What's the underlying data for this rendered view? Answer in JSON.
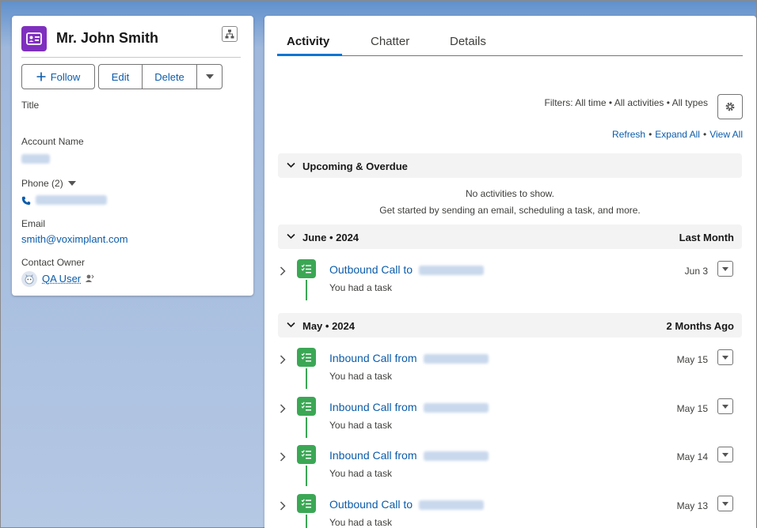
{
  "record": {
    "title": "Mr. John Smith",
    "actions": {
      "follow": "Follow",
      "edit": "Edit",
      "delete": "Delete"
    },
    "fields": {
      "title_label": "Title",
      "account_label": "Account Name",
      "phone_label": "Phone (2)",
      "email_label": "Email",
      "email_value": "smith@voximplant.com",
      "owner_label": "Contact Owner",
      "owner_value": "QA User"
    }
  },
  "tabs": [
    {
      "label": "Activity",
      "active": true
    },
    {
      "label": "Chatter",
      "active": false
    },
    {
      "label": "Details",
      "active": false
    }
  ],
  "activity": {
    "filters": "Filters: All time • All activities • All types",
    "links": {
      "refresh": "Refresh",
      "expand_all": "Expand All",
      "view_all": "View All",
      "separator": "•"
    },
    "upcoming": {
      "title": "Upcoming & Overdue",
      "empty_line1": "No activities to show.",
      "empty_line2": "Get started by sending an email, scheduling a task, and more."
    },
    "groups": [
      {
        "title": "June • 2024",
        "relative": "Last Month",
        "items": [
          {
            "title": "Outbound Call to",
            "subtitle": "You had a task",
            "date": "Jun 3"
          }
        ]
      },
      {
        "title": "May • 2024",
        "relative": "2 Months Ago",
        "items": [
          {
            "title": "Inbound Call from",
            "subtitle": "You had a task",
            "date": "May 15"
          },
          {
            "title": "Inbound Call from",
            "subtitle": "You had a task",
            "date": "May 15"
          },
          {
            "title": "Inbound Call from",
            "subtitle": "You had a task",
            "date": "May 14"
          },
          {
            "title": "Outbound Call to",
            "subtitle": "You had a task",
            "date": "May 13"
          }
        ]
      }
    ]
  },
  "colors": {
    "contact_icon": "#7f2fbf",
    "task_icon": "#3ba755",
    "link": "#0b5cab",
    "tab_active": "#0176d3"
  },
  "icons": {
    "record": "contact-card-icon",
    "hierarchy": "hierarchy-icon",
    "follow": "plus-icon",
    "more": "chevron-down-icon",
    "phone": "phone-icon",
    "owner": "user-avatar-icon",
    "owner_change": "change-owner-icon",
    "settings": "gear-icon",
    "task": "task-icon",
    "expand": "chevron-right-icon"
  }
}
